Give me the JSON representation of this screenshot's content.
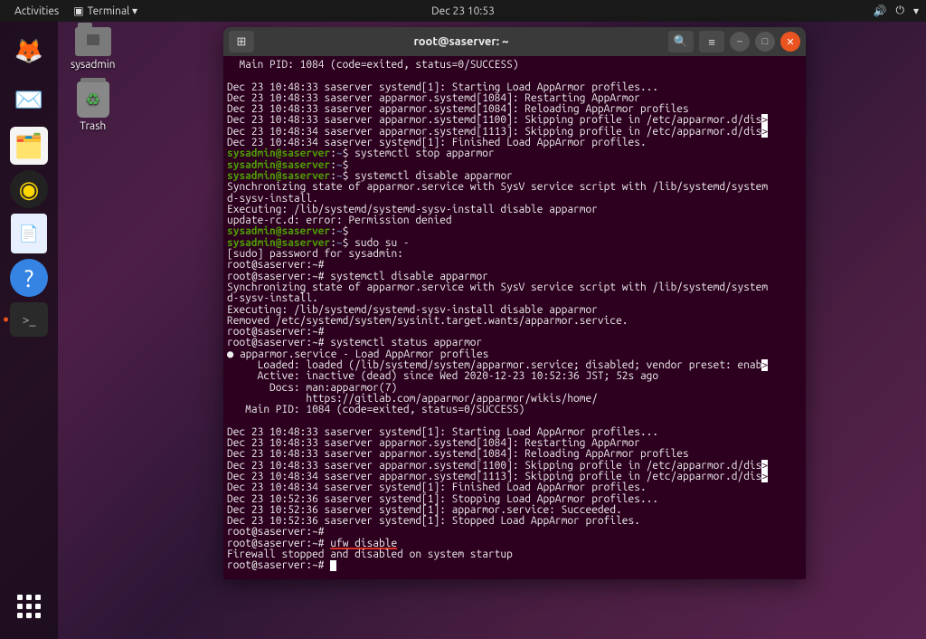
{
  "topbar": {
    "activities": "Activities",
    "appmenu": "Terminal ▾",
    "clock": "Dec 23  10:53"
  },
  "desktop": {
    "home_label": "sysadmin",
    "trash_label": "Trash"
  },
  "terminal": {
    "title": "root@saserver: ~",
    "lines": {
      "l0": "  Main PID: 1084 (code=exited, status=0/SUCCESS)",
      "blank": "",
      "l1": "Dec 23 10:48:33 saserver systemd[1]: Starting Load AppArmor profiles...",
      "l2": "Dec 23 10:48:33 saserver apparmor.systemd[1084]: Restarting AppArmor",
      "l3": "Dec 23 10:48:33 saserver apparmor.systemd[1084]: Reloading AppArmor profiles",
      "l4": "Dec 23 10:48:33 saserver apparmor.systemd[1100]: Skipping profile in /etc/apparmor.d/dis",
      "l5": "Dec 23 10:48:34 saserver apparmor.systemd[1113]: Skipping profile in /etc/apparmor.d/dis",
      "l6": "Dec 23 10:48:34 saserver systemd[1]: Finished Load AppArmor profiles.",
      "p1_user": "sysadmin@saserver",
      "p1_sep": ":",
      "p1_path": "~",
      "p1_cmd": "$ systemctl stop apparmor",
      "p2_cmd": "$",
      "p3_cmd": "$ systemctl disable apparmor",
      "l7": "Synchronizing state of apparmor.service with SysV service script with /lib/systemd/system",
      "l8": "d-sysv-install.",
      "l9": "Executing: /lib/systemd/systemd-sysv-install disable apparmor",
      "l10": "update-rc.d: error: Permission denied",
      "p4_cmd": "$",
      "p5_cmd": "$ sudo su -",
      "l11": "[sudo] password for sysadmin:",
      "l12": "root@saserver:~#",
      "l13": "root@saserver:~# systemctl disable apparmor",
      "l14": "Synchronizing state of apparmor.service with SysV service script with /lib/systemd/system",
      "l15": "d-sysv-install.",
      "l16": "Executing: /lib/systemd/systemd-sysv-install disable apparmor",
      "l17": "Removed /etc/systemd/system/sysinit.target.wants/apparmor.service.",
      "l18": "root@saserver:~#",
      "l19": "root@saserver:~# systemctl status apparmor",
      "l20": "● apparmor.service - Load AppArmor profiles",
      "l21": "     Loaded: loaded (/lib/systemd/system/apparmor.service; disabled; vendor preset: enab",
      "l22": "     Active: inactive (dead) since Wed 2020-12-23 10:52:36 JST; 52s ago",
      "l23": "       Docs: man:apparmor(7)",
      "l24": "             https://gitlab.com/apparmor/apparmor/wikis/home/",
      "l25": "   Main PID: 1084 (code=exited, status=0/SUCCESS)",
      "l26": "Dec 23 10:48:33 saserver systemd[1]: Starting Load AppArmor profiles...",
      "l27": "Dec 23 10:48:33 saserver apparmor.systemd[1084]: Restarting AppArmor",
      "l28": "Dec 23 10:48:33 saserver apparmor.systemd[1084]: Reloading AppArmor profiles",
      "l29": "Dec 23 10:48:33 saserver apparmor.systemd[1100]: Skipping profile in /etc/apparmor.d/dis",
      "l30": "Dec 23 10:48:34 saserver apparmor.systemd[1113]: Skipping profile in /etc/apparmor.d/dis",
      "l31": "Dec 23 10:48:34 saserver systemd[1]: Finished Load AppArmor profiles.",
      "l32": "Dec 23 10:52:36 saserver systemd[1]: Stopping Load AppArmor profiles...",
      "l33": "Dec 23 10:52:36 saserver systemd[1]: apparmor.service: Succeeded.",
      "l34": "Dec 23 10:52:36 saserver systemd[1]: Stopped Load AppArmor profiles.",
      "l35": "root@saserver:~#",
      "l36a": "root@saserver:~# ",
      "l36b": "ufw disable",
      "l37": "Firewall stopped and disabled on system startup",
      "l38": "root@saserver:~# "
    }
  }
}
